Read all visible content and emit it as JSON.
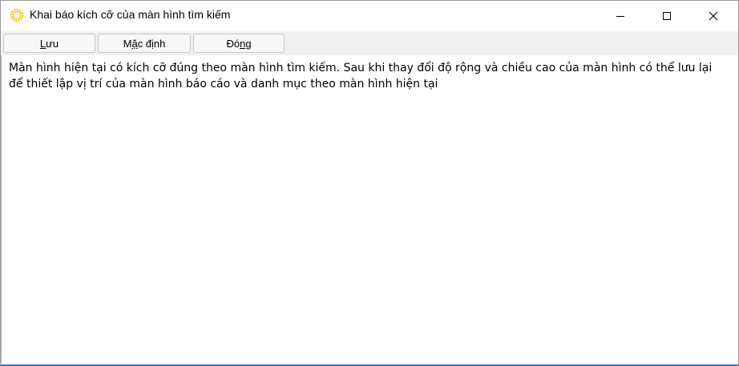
{
  "window": {
    "title": "Khai báo kích cỡ của màn hình tìm kiếm",
    "app_icon": "sun-gear-icon",
    "controls": {
      "minimize_icon": "minimize-icon",
      "maximize_icon": "maximize-icon",
      "close_icon": "close-icon"
    }
  },
  "toolbar": {
    "save": {
      "mnemonic": "L",
      "rest": "ưu"
    },
    "default": {
      "lead": "M",
      "mnemonic": "ặ",
      "rest": "c định"
    },
    "close": {
      "lead": "Đó",
      "mnemonic": "n",
      "rest": "g"
    }
  },
  "content": {
    "message": "Màn hình hiện tại có kích cỡ đúng theo màn hình tìm kiếm. Sau khi thay đổi độ rộng và chiều cao của màn hình có thể lưu lại để thiết lập vị trí của màn hình báo cáo và danh mục theo màn hình hiện tại"
  },
  "colors": {
    "accent_border": "#3b78c8",
    "toolbar_bg": "#f0f0f0",
    "icon_yellow": "#f2c200"
  }
}
